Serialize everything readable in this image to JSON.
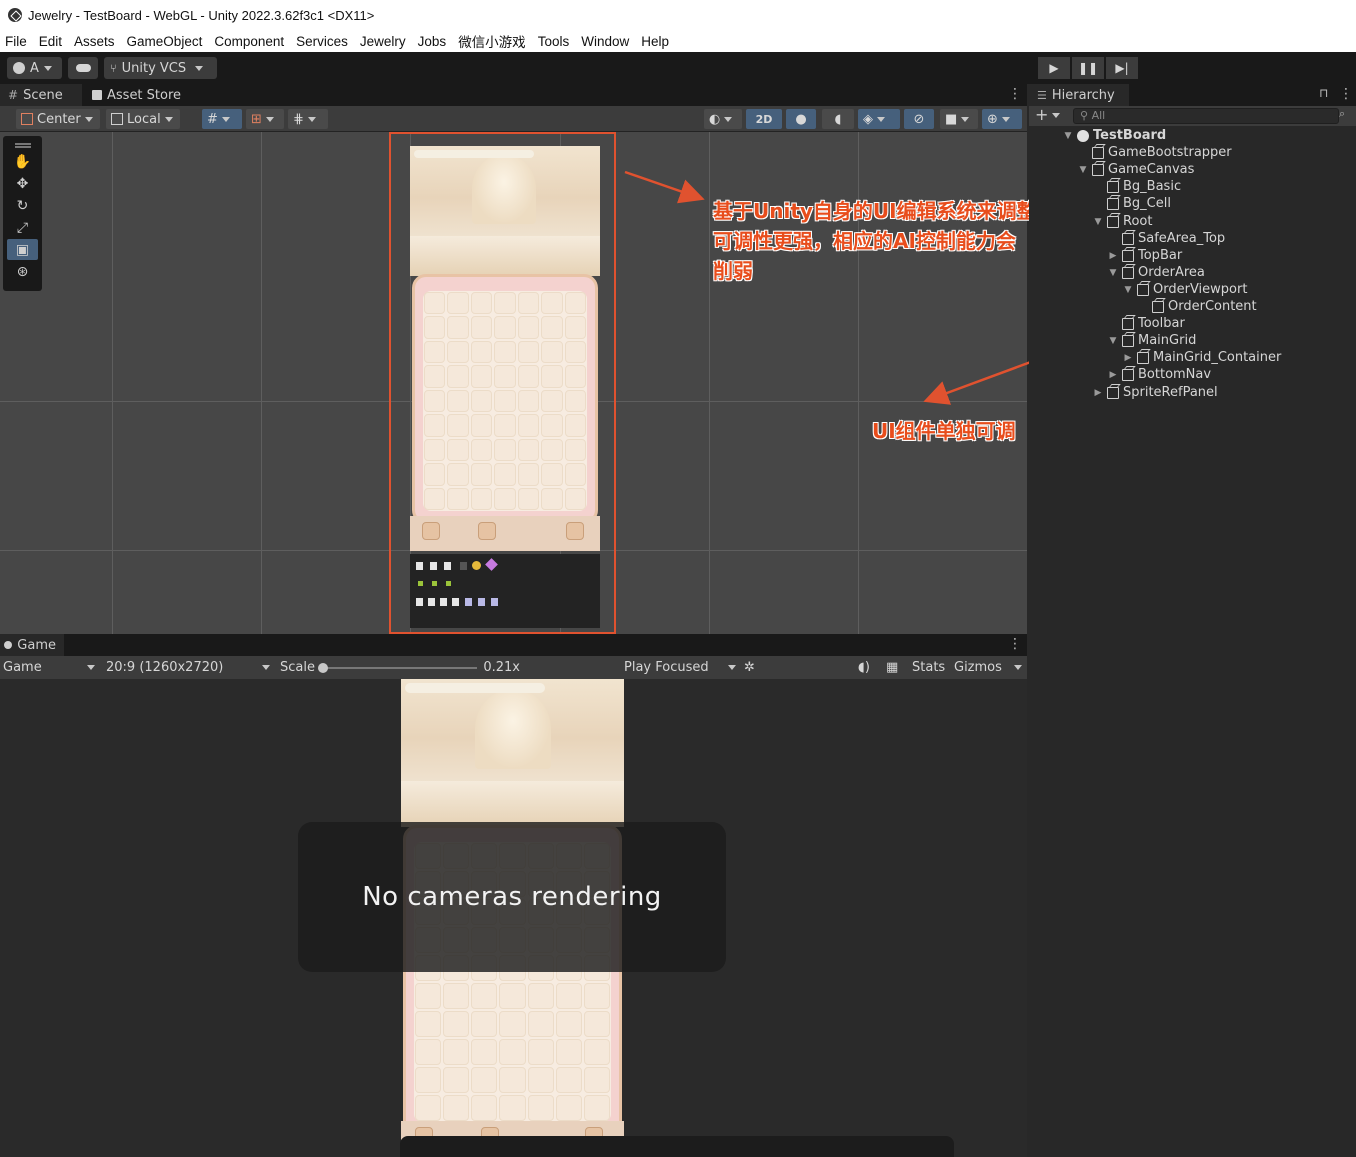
{
  "window": {
    "title": "Jewelry - TestBoard - WebGL - Unity 2022.3.62f3c1 <DX11>"
  },
  "menu": [
    "File",
    "Edit",
    "Assets",
    "GameObject",
    "Component",
    "Services",
    "Jewelry",
    "Jobs",
    "微信小游戏",
    "Tools",
    "Window",
    "Help"
  ],
  "toolbar": {
    "account": "A",
    "vcs": "Unity VCS"
  },
  "scene": {
    "tabs": [
      "Scene",
      "Asset Store"
    ],
    "pivot": "Center",
    "space": "Local",
    "mode2d": "2D"
  },
  "annotations": {
    "main": "基于Unity自身的UI编辑系统来调整\n可调性更强，相应的AI控制能力会\n削弱",
    "hierarchy": "UI组件单独可调"
  },
  "game": {
    "tab": "Game",
    "display": "Game",
    "resolution": "20:9 (1260x2720)",
    "scale_label": "Scale",
    "scale_value": "0.21x",
    "play_mode": "Play Focused",
    "stats": "Stats",
    "gizmos": "Gizmos",
    "overlay": "No cameras rendering"
  },
  "hierarchy": {
    "tab": "Hierarchy",
    "search_placeholder": "All",
    "items": [
      {
        "label": "TestBoard",
        "depth": 0,
        "arrow": "open",
        "icon": "unity-scene-icon",
        "bold": true
      },
      {
        "label": "GameBootstrapper",
        "depth": 1,
        "arrow": "none",
        "icon": "gameobject-icon"
      },
      {
        "label": "GameCanvas",
        "depth": 1,
        "arrow": "open",
        "icon": "gameobject-icon"
      },
      {
        "label": "Bg_Basic",
        "depth": 2,
        "arrow": "none",
        "icon": "gameobject-icon"
      },
      {
        "label": "Bg_Cell",
        "depth": 2,
        "arrow": "none",
        "icon": "gameobject-icon"
      },
      {
        "label": "Root",
        "depth": 2,
        "arrow": "open",
        "icon": "gameobject-icon"
      },
      {
        "label": "SafeArea_Top",
        "depth": 3,
        "arrow": "none",
        "icon": "gameobject-icon"
      },
      {
        "label": "TopBar",
        "depth": 3,
        "arrow": "closed",
        "icon": "gameobject-icon"
      },
      {
        "label": "OrderArea",
        "depth": 3,
        "arrow": "open",
        "icon": "gameobject-icon"
      },
      {
        "label": "OrderViewport",
        "depth": 4,
        "arrow": "open",
        "icon": "gameobject-icon"
      },
      {
        "label": "OrderContent",
        "depth": 5,
        "arrow": "none",
        "icon": "gameobject-icon"
      },
      {
        "label": "Toolbar",
        "depth": 3,
        "arrow": "none",
        "icon": "gameobject-icon"
      },
      {
        "label": "MainGrid",
        "depth": 3,
        "arrow": "open",
        "icon": "gameobject-icon"
      },
      {
        "label": "MainGrid_Container",
        "depth": 4,
        "arrow": "closed",
        "icon": "gameobject-icon"
      },
      {
        "label": "BottomNav",
        "depth": 3,
        "arrow": "closed",
        "icon": "gameobject-icon"
      },
      {
        "label": "SpriteRefPanel",
        "depth": 2,
        "arrow": "closed",
        "icon": "gameobject-icon"
      }
    ]
  },
  "colors": {
    "annotation": "#e84d1c",
    "selection": "#46607c",
    "panel": "#282828"
  }
}
